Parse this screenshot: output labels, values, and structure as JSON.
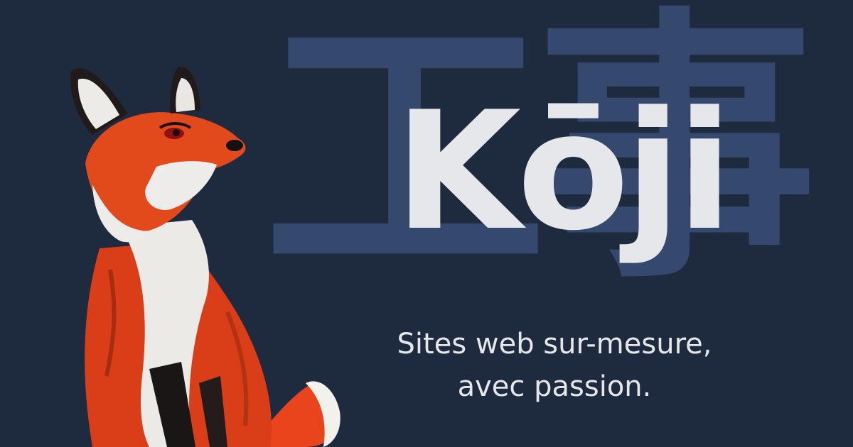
{
  "brand": {
    "name": "Kōji",
    "kanji": "工事"
  },
  "tagline": {
    "line1": "Sites web sur-mesure,",
    "line2": "avec passion."
  },
  "colors": {
    "background": "#1e2a3e",
    "kanji": "#34496d",
    "text": "#e6e7ea",
    "fox_orange": "#e8451c"
  },
  "illustration": "fox-illustration"
}
